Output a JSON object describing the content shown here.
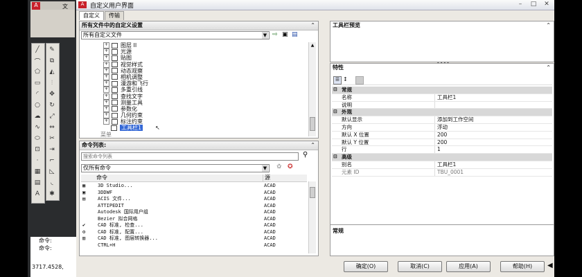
{
  "cad": {
    "menu_label": "文",
    "cmd_prompt_1": "命令:",
    "cmd_prompt_2": "命令:",
    "coords": "3717.4528,"
  },
  "dialog": {
    "title": "自定义用户界面",
    "tabs": [
      "自定义",
      "传输"
    ],
    "customizations_header": "所有文件中的自定义设置",
    "file_combo": "所有自定义文件",
    "tree": [
      {
        "label": "图层 II"
      },
      {
        "label": "光源"
      },
      {
        "label": "贴图"
      },
      {
        "label": "视觉样式"
      },
      {
        "label": "动态观察"
      },
      {
        "label": "相机调整"
      },
      {
        "label": "漫游和飞行"
      },
      {
        "label": "多重引线"
      },
      {
        "label": "查找文字"
      },
      {
        "label": "测量工具"
      },
      {
        "label": "参数化"
      },
      {
        "label": "几何约束"
      },
      {
        "label": "标注约束"
      }
    ],
    "tree_selected": "工具栏1",
    "tree_partial": "菜单",
    "command_list_header": "命令列表:",
    "search_placeholder": "搜索命令列表",
    "filter_combo": "仅所有命令",
    "col_command": "命令",
    "col_source": "源",
    "commands": [
      {
        "name": "3D Studio...",
        "src": "ACAD",
        "icon": "3ds-icon"
      },
      {
        "name": "3DDWF",
        "src": "ACAD",
        "icon": "3ddwf-icon"
      },
      {
        "name": "ACIS 文件...",
        "src": "ACAD",
        "icon": "acis-icon"
      },
      {
        "name": "ATTIPEDIT",
        "src": "ACAD",
        "icon": ""
      },
      {
        "name": "Autodesk 国际用户组",
        "src": "ACAD",
        "icon": ""
      },
      {
        "name": "Bezier 拟合网格",
        "src": "ACAD",
        "icon": ""
      },
      {
        "name": "CAD 标准, 检查...",
        "src": "ACAD",
        "icon": "check-icon"
      },
      {
        "name": "CAD 标准, 配置...",
        "src": "ACAD",
        "icon": "config-icon"
      },
      {
        "name": "CAD 标准, 图层转换器...",
        "src": "ACAD",
        "icon": "layer-icon"
      },
      {
        "name": "CTRL+H",
        "src": "ACAD",
        "icon": ""
      }
    ],
    "preview_header": "工具栏预览",
    "properties_header": "特性",
    "props": [
      {
        "cat": "常规"
      },
      {
        "k": "名称",
        "v": "工具栏1"
      },
      {
        "k": "说明",
        "v": ""
      },
      {
        "cat": "外观"
      },
      {
        "k": "默认显示",
        "v": "添加到工作空间"
      },
      {
        "k": "方向",
        "v": "浮动"
      },
      {
        "k": "默认 X 位置",
        "v": "200"
      },
      {
        "k": "默认 Y 位置",
        "v": "200"
      },
      {
        "k": "行",
        "v": "1"
      },
      {
        "cat": "高级"
      },
      {
        "k": "别名",
        "v": "工具栏1"
      },
      {
        "k": "元素 ID",
        "v": "TBU_0001",
        "dim": true
      }
    ],
    "desc_title": "常规",
    "buttons": {
      "ok": "确定(O)",
      "cancel": "取消(C)",
      "apply": "应用(A)",
      "help": "帮助(H)"
    }
  }
}
